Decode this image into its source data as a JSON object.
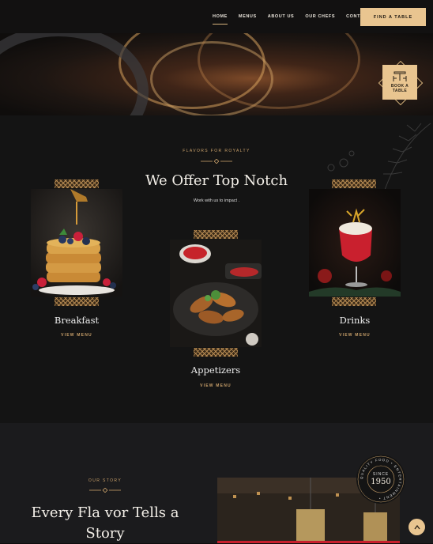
{
  "nav": {
    "items": [
      {
        "label": "HOME",
        "active": true
      },
      {
        "label": "MENUS",
        "active": false
      },
      {
        "label": "ABOUT US",
        "active": false
      },
      {
        "label": "OUR CHEFS",
        "active": false
      },
      {
        "label": "CONTACT",
        "active": false
      }
    ],
    "cta_label": "FIND A TABLE"
  },
  "hero": {
    "book_label_1": "BOOK A",
    "book_label_2": "TABLE"
  },
  "offer": {
    "eyebrow": "FLAVORS FOR ROYALTY",
    "title": "We Offer Top Notch",
    "subtitle": "Work with us to impact .",
    "cards": [
      {
        "name": "Breakfast",
        "link": "VIEW MENU"
      },
      {
        "name": "Appetizers",
        "link": "VIEW MENU"
      },
      {
        "name": "Drinks",
        "link": "VIEW MENU"
      }
    ]
  },
  "story": {
    "eyebrow": "OUR STORY",
    "title_line1": "Every Fla vor Tells a",
    "title_line2": "Story",
    "badge_top": "SINCE",
    "badge_year": "1950",
    "badge_ring": "QUALITY FOOD • ENTERTAINMENT •"
  },
  "colors": {
    "accent": "#e9c590",
    "gold": "#c9a06a",
    "bg_dark": "#141414"
  }
}
